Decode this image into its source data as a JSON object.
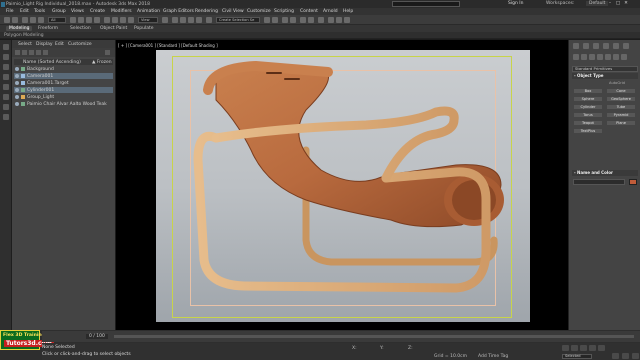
{
  "window": {
    "title": "Paimio_Light Rig Individual_2018.max - Autodesk 3ds Max 2018",
    "search_placeholder": "Type a keyword or phrase",
    "sign_in": "Sign In",
    "workspaces_label": "Workspaces:",
    "workspace_value": "Default",
    "controls": [
      "–",
      "□",
      "✕"
    ]
  },
  "menu": [
    "File",
    "Edit",
    "Tools",
    "Group",
    "Views",
    "Create",
    "Modifiers",
    "Animation",
    "Graph Editors",
    "Rendering",
    "Civil View",
    "Customize",
    "Scripting",
    "Content",
    "Arnold",
    "Help"
  ],
  "toolbar": {
    "filter_value": "All",
    "view_value": "View",
    "selection_set": "Create Selection Se"
  },
  "ribbon": {
    "tabs": [
      "Modeling",
      "Freeform",
      "Selection",
      "Object Paint",
      "Populate"
    ],
    "active_tab": "Modeling",
    "sub_label": "Polygon Modeling"
  },
  "explorer": {
    "tabs": [
      "Select",
      "Display",
      "Edit",
      "Customize"
    ],
    "header_name": "Name (Sorted Ascending)",
    "header_frozen": "▲ Frozen",
    "rows": [
      {
        "label": "Background",
        "selected": false
      },
      {
        "label": "Camera001",
        "selected": true
      },
      {
        "label": "Camera001.Target",
        "selected": false
      },
      {
        "label": "Cylinder001",
        "selected": true
      },
      {
        "label": "Group_Light",
        "selected": false
      },
      {
        "label": "Paimio Chair Alvar Aalto Wood Teak",
        "selected": false
      }
    ]
  },
  "viewport": {
    "label": "[ + ] [Camera001 ] [Standard ] [Default Shading ]"
  },
  "command_panel": {
    "dropdown_value": "Standard Primitives",
    "object_type_title": "- Object Type",
    "autogrid_label": "AutoGrid",
    "buttons": [
      "Box",
      "Cone",
      "Sphere",
      "GeoSphere",
      "Cylinder",
      "Tube",
      "Torus",
      "Pyramid",
      "Teapot",
      "Plane",
      "TextPlus"
    ],
    "name_color_title": "- Name and Color",
    "swatch_color": "#c15c3a"
  },
  "branding": {
    "line1": "Flex 3D Trainings",
    "line2": "Tutors3d.com"
  },
  "timeline": {
    "frame_info": "0 / 100"
  },
  "status": {
    "selection": "None Selected",
    "prompt": "Click or click-and-drag to select objects",
    "x_label": "X:",
    "y_label": "Y:",
    "z_label": "Z:",
    "grid": "Grid = 10.0cm",
    "add_time_tag": "Add Time Tag",
    "auto_key": "Selected"
  },
  "colors": {
    "wood_frame": "#d9a878",
    "teak_seat": "#b86a3e",
    "safe_frame_outer": "#c8d44a",
    "safe_frame_inner": "#e9c2a8"
  }
}
